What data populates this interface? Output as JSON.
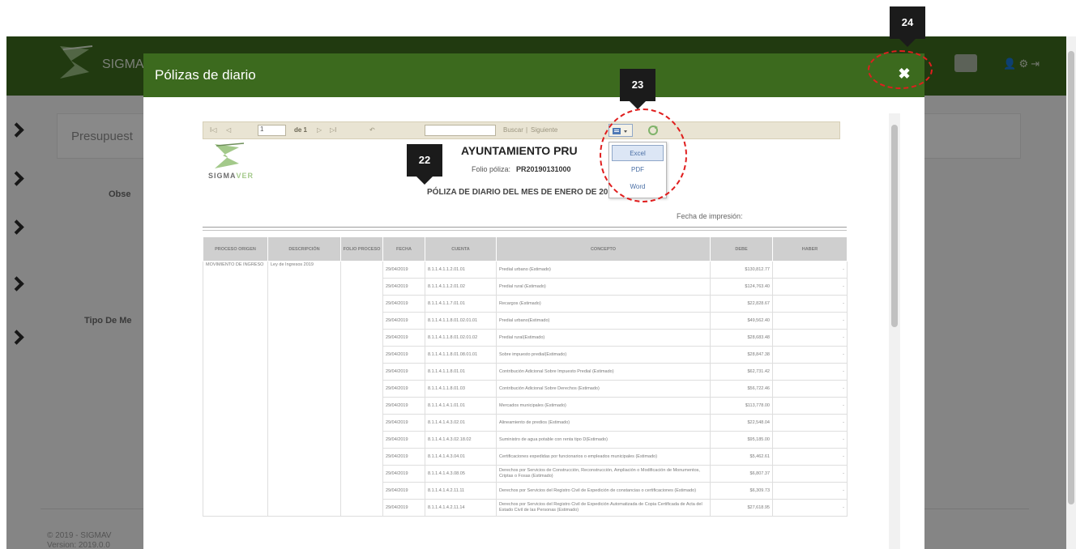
{
  "app": {
    "name": "SIGMA",
    "header_icons": "  ",
    "bg_title": "Presupuest",
    "bg_label_obs": "Obse",
    "bg_label_tipo": "Tipo De Me",
    "footer_copyright": "© 2019 - SIGMAV",
    "footer_version": "Version: 2019.0.0"
  },
  "modal": {
    "title": "Pólizas de diario",
    "close_symbol": "✖"
  },
  "toolbar": {
    "first": "I◁",
    "prev": "◁",
    "page_value": "1",
    "of_label": "de 1",
    "next": "▷",
    "last": "▷I",
    "back": "↶",
    "search_label": "Buscar",
    "sep": "|",
    "next_label": "Siguiente",
    "export_options": [
      "Excel",
      "PDF",
      "Word"
    ]
  },
  "report": {
    "logo_text_a": "SIGMA",
    "logo_text_b": "VER",
    "title": "AYUNTAMIENTO PRU",
    "folio_label": "Folio póliza:",
    "folio_value": "PR20190131000",
    "subtitle": "PÓLIZA DE DIARIO DEL MES DE ENERO DE 2019",
    "print_date_label": "Fecha de impresión:",
    "columns": [
      "PROCESO ORIGEN",
      "DESCRIPCIÓN",
      "FOLIO PROCESO",
      "FECHA",
      "CUENTA",
      "CONCEPTO",
      "DEBE",
      "HABER"
    ],
    "origin": "MOVIMIENTO DE INGRESO",
    "description": "Ley de Ingresos 2019",
    "rows": [
      {
        "fecha": "29/04/2019",
        "cuenta": "8.1.1.4.1.1.2.01.01",
        "concepto": "Predial urbano (Estimado)",
        "debe": "$130,812.77",
        "haber": "-"
      },
      {
        "fecha": "29/04/2019",
        "cuenta": "8.1.1.4.1.1.2.01.02",
        "concepto": "Predial rural (Estimado)",
        "debe": "$124,763.40",
        "haber": "-"
      },
      {
        "fecha": "29/04/2019",
        "cuenta": "8.1.1.4.1.1.7.01.01",
        "concepto": "Recargos (Estimado)",
        "debe": "$22,828.67",
        "haber": "-"
      },
      {
        "fecha": "29/04/2019",
        "cuenta": "8.1.1.4.1.1.8.01.02.01.01",
        "concepto": "Predial urbano(Estimado)",
        "debe": "$49,562.40",
        "haber": "-"
      },
      {
        "fecha": "29/04/2019",
        "cuenta": "8.1.1.4.1.1.8.01.02.01.02",
        "concepto": "Predial rural(Estimado)",
        "debe": "$28,683.48",
        "haber": "-"
      },
      {
        "fecha": "29/04/2019",
        "cuenta": "8.1.1.4.1.1.8.01.08.01.01",
        "concepto": "Sobre impuesto predial(Estimado)",
        "debe": "$28,847.38",
        "haber": "-"
      },
      {
        "fecha": "29/04/2019",
        "cuenta": "8.1.1.4.1.1.8.01.01",
        "concepto": "Contribución Adicional Sobre Impuesto Predial (Estimado)",
        "debe": "$62,731.42",
        "haber": "-"
      },
      {
        "fecha": "29/04/2019",
        "cuenta": "8.1.1.4.1.1.8.01.03",
        "concepto": "Contribución Adicional Sobre Derechos (Estimado)",
        "debe": "$56,722.46",
        "haber": "-"
      },
      {
        "fecha": "29/04/2019",
        "cuenta": "8.1.1.4.1.4.1.01.01",
        "concepto": "Mercados municipales (Estimado)",
        "debe": "$113,778.00",
        "haber": "-"
      },
      {
        "fecha": "29/04/2019",
        "cuenta": "8.1.1.4.1.4.3.02.01",
        "concepto": "Alineamiento de predios (Estimado)",
        "debe": "$22,548.04",
        "haber": "-"
      },
      {
        "fecha": "29/04/2019",
        "cuenta": "8.1.1.4.1.4.3.02.18.02",
        "concepto": "Suministro de agua potable con renta tipo D(Estimado)",
        "debe": "$95,185.00",
        "haber": "-"
      },
      {
        "fecha": "29/04/2019",
        "cuenta": "8.1.1.4.1.4.3.04.01",
        "concepto": "Certificaciones expedidas por funcionarios o empleados municipales (Estimado)",
        "debe": "$5,462.61",
        "haber": "-"
      },
      {
        "fecha": "29/04/2019",
        "cuenta": "8.1.1.4.1.4.3.08.05",
        "concepto": "Derechos por Servicios de Construcción, Reconstrucción, Ampliación o Modificación de Monumentos, Criptas o Fosas (Estimado)",
        "debe": "$6,807.37",
        "haber": "-"
      },
      {
        "fecha": "29/04/2019",
        "cuenta": "8.1.1.4.1.4.2.11.11",
        "concepto": "Derechos por Servicios del Registro Civil de Expedición de constancias o certificaciones (Estimado)",
        "debe": "$6,309.73",
        "haber": "-"
      },
      {
        "fecha": "29/04/2019",
        "cuenta": "8.1.1.4.1.4.2.11.14",
        "concepto": "Derechos por Servicios del Registro Civil de Expedición Automatizada de Copia Certificada de Acta del Estado Civil de las Personas (Estimado)",
        "debe": "$27,618.95",
        "haber": "-"
      }
    ]
  },
  "annotations": {
    "callout_22": "22",
    "callout_23": "23",
    "callout_24": "24"
  },
  "colors": {
    "header_green": "#3c6a1e",
    "annotation_red": "#e01e1e",
    "callout_black": "#1b1b1b"
  }
}
